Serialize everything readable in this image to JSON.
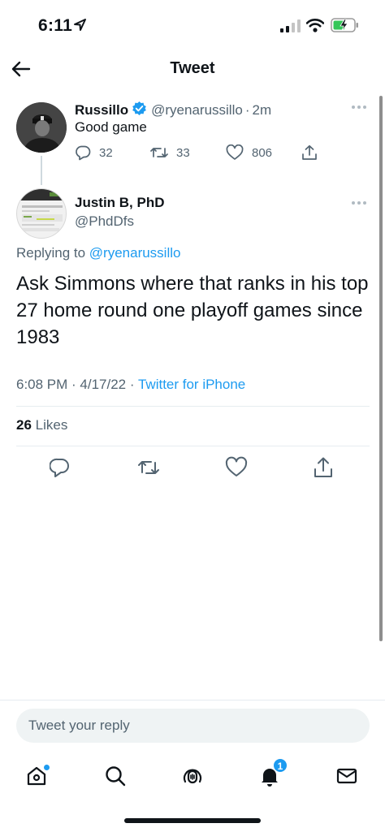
{
  "status_bar": {
    "time": "6:11"
  },
  "nav": {
    "title": "Tweet"
  },
  "parent_tweet": {
    "author_name": "Russillo",
    "handle": "@ryenarussillo",
    "separator": "·",
    "time_ago": "2m",
    "text": "Good game",
    "replies": "32",
    "retweets": "33",
    "likes": "806"
  },
  "main_tweet": {
    "author_name": "Justin B, PhD",
    "handle": "@PhdDfs",
    "replying_prefix": "Replying to ",
    "replying_handle": "@ryenarussillo",
    "text": "Ask Simmons where that ranks in his top 27 home round one playoff games since 1983",
    "time": "6:08 PM",
    "date": "4/17/22",
    "source": "Twitter for iPhone",
    "likes_count": "26",
    "likes_label": "Likes"
  },
  "reply_box": {
    "placeholder": "Tweet your reply"
  },
  "tab_bar": {
    "notifications_badge": "1"
  },
  "colors": {
    "accent": "#1d9bf0",
    "secondary_text": "#536471",
    "primary_text": "#0f1419"
  }
}
